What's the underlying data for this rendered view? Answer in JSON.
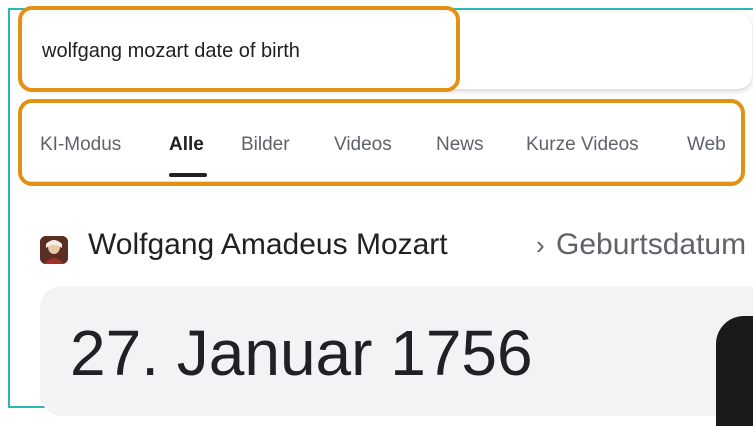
{
  "search": {
    "query": "wolfgang mozart date of birth"
  },
  "tabs": [
    {
      "label": "KI-Modus",
      "active": false
    },
    {
      "label": "Alle",
      "active": true
    },
    {
      "label": "Bilder",
      "active": false
    },
    {
      "label": "Videos",
      "active": false
    },
    {
      "label": "News",
      "active": false
    },
    {
      "label": "Kurze Videos",
      "active": false
    },
    {
      "label": "Web",
      "active": false
    }
  ],
  "result": {
    "entity_name": "Wolfgang Amadeus Mozart",
    "separator": "›",
    "attribute": "Geburtsdatum",
    "answer": "27. Januar 1756"
  },
  "colors": {
    "highlight": "#e39112",
    "frame": "#2bb8b0",
    "card_bg": "#f1f3f4"
  }
}
